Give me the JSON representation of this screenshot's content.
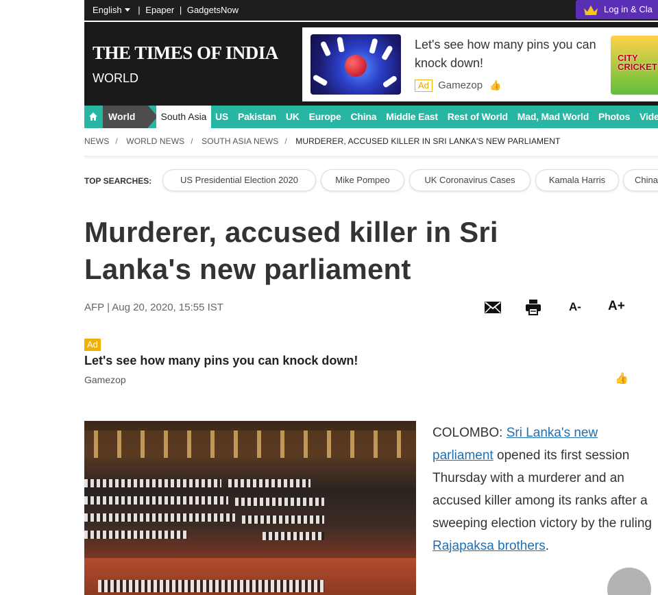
{
  "topbar": {
    "language": "English",
    "links": [
      "Epaper",
      "GadgetsNow"
    ],
    "login": "Log in & Cla"
  },
  "masthead": {
    "logo": "THE TIMES OF INDIA",
    "section": "WORLD",
    "ad": {
      "text": "Let's see how many pins you can knock down!",
      "badge": "Ad",
      "source": "Gamezop",
      "side_game_text": "CITY CRICKET"
    }
  },
  "nav": {
    "home_icon": "home-icon",
    "active": "World",
    "current": "South Asia",
    "items": [
      "US",
      "Pakistan",
      "UK",
      "Europe",
      "China",
      "Middle East",
      "Rest of World",
      "Mad, Mad World",
      "Photos",
      "Videos"
    ],
    "accent": "#26b6a1"
  },
  "breadcrumb": [
    "NEWS",
    "WORLD NEWS",
    "SOUTH ASIA NEWS",
    "MURDERER, ACCUSED KILLER IN SRI LANKA'S NEW PARLIAMENT"
  ],
  "top_searches": {
    "label": "TOP SEARCHES:",
    "items": [
      "US Presidential Election 2020",
      "Mike Pompeo",
      "UK Coronavirus Cases",
      "Kamala Harris",
      "China"
    ]
  },
  "article": {
    "headline": "Murderer, accused killer in Sri Lanka's new parliament",
    "byline": "AFP | Aug 20, 2020, 15:55 IST",
    "tools": {
      "email_icon": "email-icon",
      "print_icon": "print-icon",
      "font_smaller": "A-",
      "font_larger": "A+"
    },
    "body_prefix": "COLOMBO: ",
    "link1": "Sri Lanka's new parliament",
    "body_mid": " opened its first session Thursday with a murderer and an accused killer among its ranks after a sweeping election victory by the ruling ",
    "link2": "Rajapaksa brothers",
    "body_suffix": "."
  },
  "inline_ad": {
    "badge": "Ad",
    "title": "Let's see how many pins you can knock down!",
    "source": "Gamezop"
  }
}
